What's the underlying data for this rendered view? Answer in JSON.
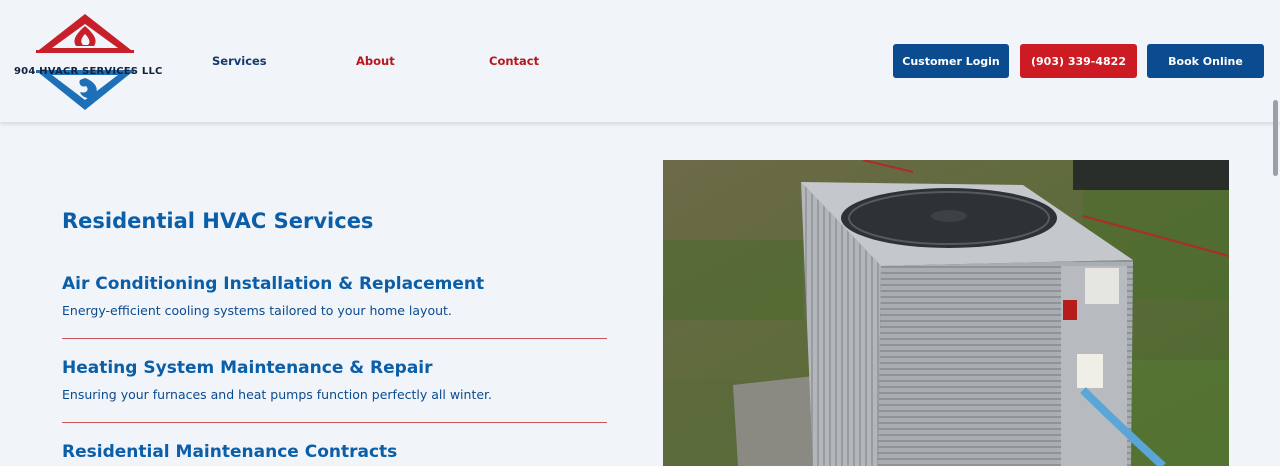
{
  "header": {
    "logo_text": "904 HVACR SERVICES LLC",
    "nav": {
      "services": "Services",
      "about": "About",
      "contact": "Contact"
    },
    "buttons": {
      "login": "Customer Login",
      "phone": "(903) 339-4822",
      "book": "Book Online"
    }
  },
  "main": {
    "section_title": "Residential HVAC Services",
    "services": [
      {
        "title": "Air Conditioning Installation & Replacement",
        "description": "Energy-efficient cooling systems tailored to your home layout."
      },
      {
        "title": "Heating System Maintenance & Repair",
        "description": "Ensuring your furnaces and heat pumps function perfectly all winter."
      },
      {
        "title": "Residential Maintenance Contracts"
      }
    ]
  },
  "colors": {
    "brand_blue": "#0b4b8f",
    "brand_red": "#cc1b22",
    "heading_blue": "#0b5ea8"
  }
}
